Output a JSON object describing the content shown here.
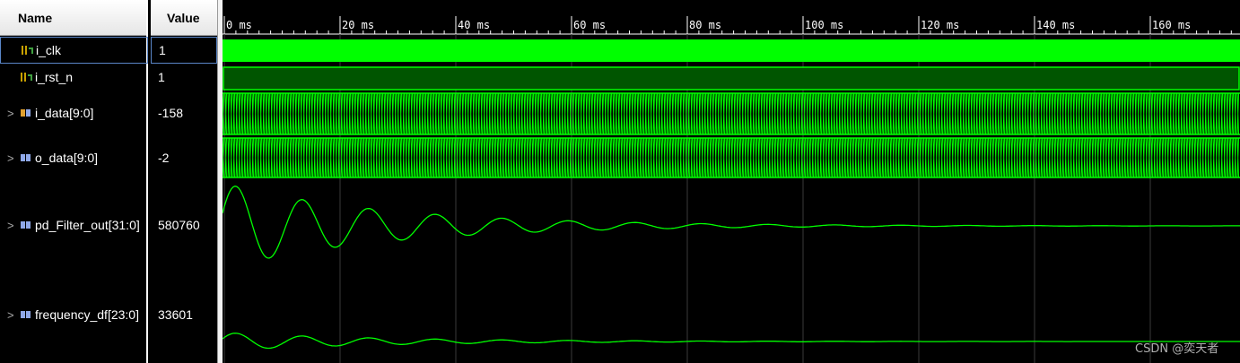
{
  "columns": {
    "name": "Name",
    "value": "Value"
  },
  "signals": [
    {
      "name": "i_clk",
      "value": "1",
      "kind": "bit-icon",
      "expandable": false,
      "selected": true
    },
    {
      "name": "i_rst_n",
      "value": "1",
      "kind": "bit-icon",
      "expandable": false,
      "selected": false
    },
    {
      "name": "i_data[9:0]",
      "value": "-158",
      "kind": "bus-icon",
      "expandable": true,
      "selected": false
    },
    {
      "name": "o_data[9:0]",
      "value": "-2",
      "kind": "bus-icon",
      "expandable": true,
      "selected": false
    },
    {
      "name": "pd_Filter_out[31:0]",
      "value": "580760",
      "kind": "bus-icon",
      "expandable": true,
      "selected": false
    },
    {
      "name": "frequency_df[23:0]",
      "value": "33601",
      "kind": "bus-icon",
      "expandable": true,
      "selected": false
    }
  ],
  "timeline": {
    "labels": [
      "0 ms",
      "20 ms",
      "40 ms",
      "60 ms",
      "80 ms",
      "100 ms",
      "120 ms",
      "140 ms",
      "160 ms"
    ],
    "major_step_ms": 20,
    "minor_per_major": 10,
    "visible_end_ms": 175
  },
  "colors": {
    "wave": "#00ff00",
    "wave_dark": "#005500",
    "grid": "#3a3a3a",
    "ruler_text": "#ffffff"
  },
  "expand_glyph": ">",
  "watermark": "CSDN @奕天者"
}
